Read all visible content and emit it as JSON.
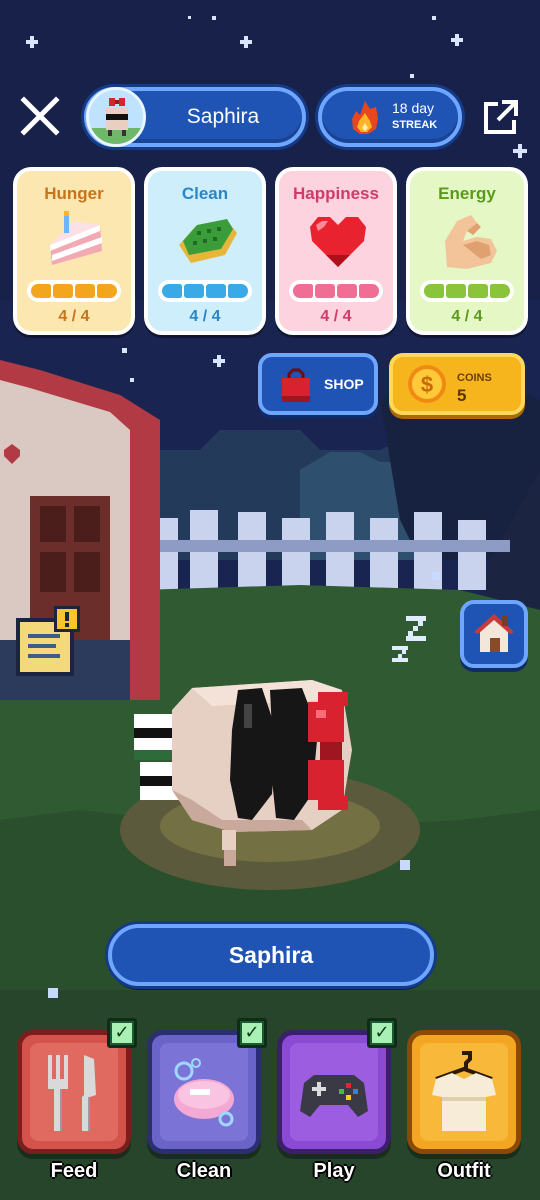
{
  "header": {
    "profile_name": "Saphira",
    "streak_value": "18 day",
    "streak_label": "STREAK"
  },
  "stats": [
    {
      "title": "Hunger",
      "value": "4 / 4",
      "filled": 4,
      "total": 4,
      "icon": "cake-icon",
      "title_color": "#c8741a",
      "card_color": "#fde7b0",
      "bar_color": "#f4a51e"
    },
    {
      "title": "Clean",
      "value": "4 / 4",
      "filled": 4,
      "total": 4,
      "icon": "sponge-icon",
      "title_color": "#2a86c6",
      "card_color": "#cfeefb",
      "bar_color": "#39a9e8"
    },
    {
      "title": "Happiness",
      "value": "4 / 4",
      "filled": 4,
      "total": 4,
      "icon": "heart-icon",
      "title_color": "#d23a6c",
      "card_color": "#fcd3de",
      "bar_color": "#f06d93"
    },
    {
      "title": "Energy",
      "value": "4 / 4",
      "filled": 4,
      "total": 4,
      "icon": "muscle-icon",
      "title_color": "#5a9b1e",
      "card_color": "#e4f7c4",
      "bar_color": "#8ac43a"
    }
  ],
  "shop": {
    "label": "SHOP"
  },
  "coins": {
    "label": "COINS",
    "value": "5"
  },
  "pet": {
    "name": "Saphira",
    "state": "sleeping"
  },
  "actions": [
    {
      "label": "Feed",
      "icon": "fork-knife-icon",
      "checked": true
    },
    {
      "label": "Clean",
      "icon": "soap-icon",
      "checked": true
    },
    {
      "label": "Play",
      "icon": "gamepad-icon",
      "checked": true
    },
    {
      "label": "Outfit",
      "icon": "shirt-hanger-icon",
      "checked": false
    }
  ],
  "colors": {
    "sky": "#1a2450",
    "grass": "#2f5a32",
    "accent_blue": "#1f54b5",
    "coin_gold": "#f6b51c"
  }
}
